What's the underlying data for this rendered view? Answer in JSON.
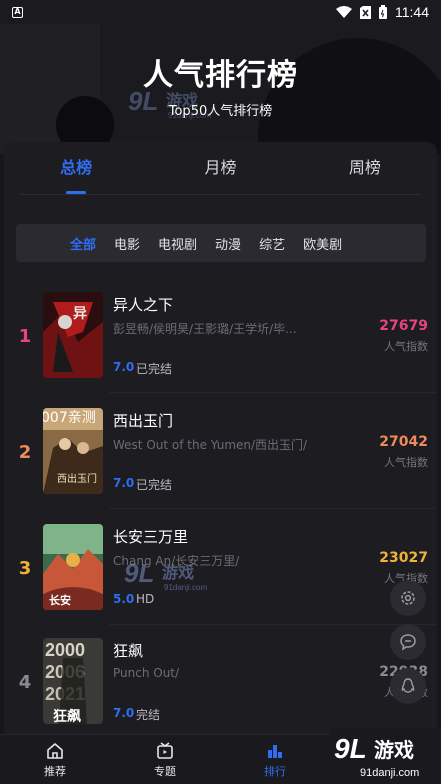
{
  "status_bar": {
    "time": "11:44",
    "left_badge": "A"
  },
  "header": {
    "title": "人气排行榜",
    "subtitle": "Top50人气排行榜"
  },
  "tabs": [
    {
      "label": "总榜",
      "active": true
    },
    {
      "label": "月榜"
    },
    {
      "label": "周榜"
    }
  ],
  "filters": [
    {
      "label": "全部",
      "active": true
    },
    {
      "label": "电影"
    },
    {
      "label": "电视剧"
    },
    {
      "label": "动漫"
    },
    {
      "label": "综艺"
    },
    {
      "label": "欧美剧"
    }
  ],
  "items": [
    {
      "rank": "1",
      "title": "异人之下",
      "cast": "彭昱畅/侯明昊/王影璐/王学圻/毕...",
      "score": "7.0",
      "status": "已完结",
      "heat": "27679",
      "heat_label": "人气指数",
      "rank_color": "#e8447e",
      "heat_color": "#e8447e"
    },
    {
      "rank": "2",
      "title": "西出玉门",
      "cast": "West Out of the Yumen/西出玉门/",
      "score": "7.0",
      "status": "已完结",
      "heat": "27042",
      "heat_label": "人气指数",
      "poster_text": "007亲测",
      "rank_color": "#f08a5a",
      "heat_color": "#f08a5a"
    },
    {
      "rank": "3",
      "title": "长安三万里",
      "cast": "Chang An/长安三万里/",
      "score": "5.0",
      "status": "HD",
      "heat": "23027",
      "heat_label": "人气指数",
      "rank_color": "#f0b23a",
      "heat_color": "#f0b23a"
    },
    {
      "rank": "4",
      "title": "狂飙",
      "cast": "Punch Out/",
      "score": "7.0",
      "status": "完结",
      "heat": "22938",
      "heat_label": "人气指数",
      "poster_text": "狂飙",
      "rank_color": "#8a8a92",
      "heat_color": "#8a8a92"
    }
  ],
  "bottom_nav": [
    {
      "label": "推荐",
      "icon": "home-icon"
    },
    {
      "label": "专题",
      "icon": "topic-icon"
    },
    {
      "label": "排行",
      "icon": "rank-icon",
      "active": true
    }
  ],
  "watermark": {
    "brand": "游戏",
    "domain": "91danji.com"
  }
}
